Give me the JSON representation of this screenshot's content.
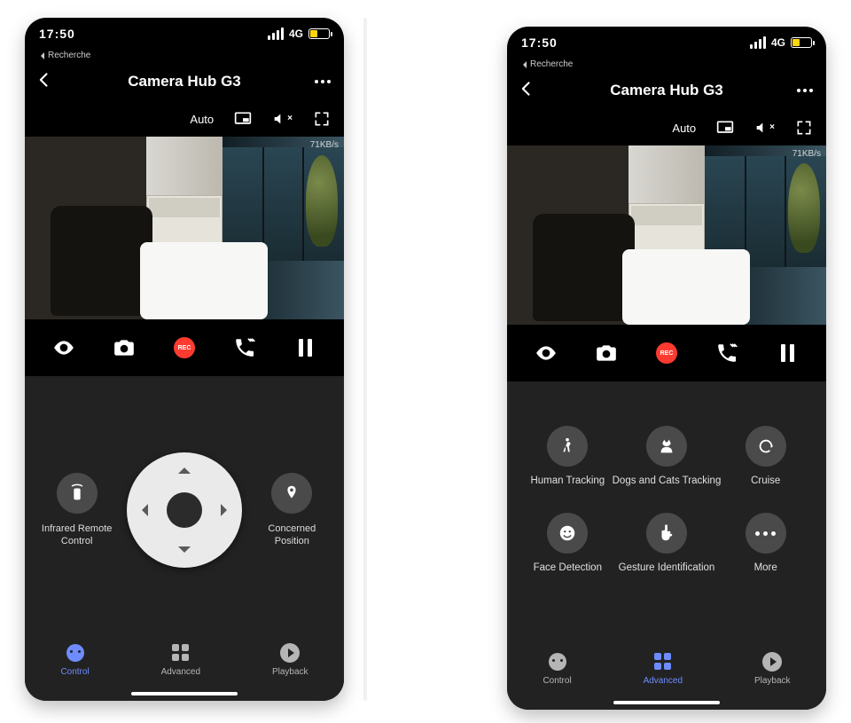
{
  "status": {
    "time": "17:50",
    "network": "4G",
    "sub_label": "Recherche"
  },
  "header": {
    "title": "Camera Hub G3"
  },
  "video_toolbar": {
    "quality": "Auto"
  },
  "video": {
    "bitrate": "71KB/s"
  },
  "record_badge": "REC",
  "left_panel": {
    "infrared_label": "Infrared Remote Control",
    "concerned_label": "Concerned Position"
  },
  "adv_items": {
    "human": "Human Tracking",
    "pets": "Dogs and Cats Tracking",
    "cruise": "Cruise",
    "face": "Face Detection",
    "gesture": "Gesture Identification",
    "more": "More"
  },
  "tabs": {
    "control": "Control",
    "advanced": "Advanced",
    "playback": "Playback"
  }
}
